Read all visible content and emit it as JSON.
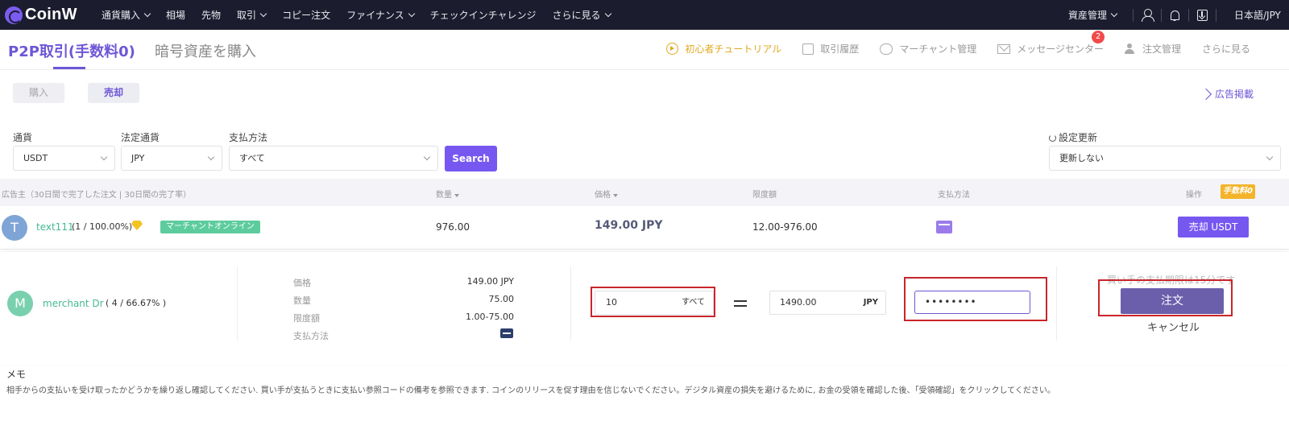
{
  "nav": {
    "logo": "CoinW",
    "items": [
      {
        "label": "通貨購入",
        "caret": true
      },
      {
        "label": "相場",
        "caret": false
      },
      {
        "label": "先物",
        "caret": false
      },
      {
        "label": "取引",
        "caret": true
      },
      {
        "label": "コピー注文",
        "caret": false
      },
      {
        "label": "ファイナンス",
        "caret": true
      },
      {
        "label": "チェックインチャレンジ",
        "caret": false
      },
      {
        "label": "さらに見る",
        "caret": true
      }
    ],
    "asset_management": "資産管理",
    "language": "日本語/JPY",
    "icons": [
      "user-icon",
      "bell-icon",
      "download-icon"
    ]
  },
  "subheader": {
    "tab_active": "P2P取引(手数料0)",
    "tab_inactive": "暗号資産を購入",
    "links": {
      "tutorial": "初心者チュートリアル",
      "history": "取引履歴",
      "merchant": "マーチャント管理",
      "messages": "メッセージセンター",
      "messages_badge": "2",
      "orders": "注文管理",
      "more": "さらに見る"
    }
  },
  "toggles": {
    "buy": "購入",
    "sell": "売却",
    "active": "sell"
  },
  "post_ad": "広告掲載",
  "filters": {
    "currency_label": "通貨",
    "currency_value": "USDT",
    "fiat_label": "法定通貨",
    "fiat_value": "JPY",
    "payment_label": "支払方法",
    "payment_value": "すべて",
    "search": "Search",
    "refresh_label": "設定更新",
    "refresh_value": "更新しない"
  },
  "table": {
    "headers": {
      "advertiser": "広告主（30日間で完了した注文 | 30日間の完了率）",
      "quantity": "数量",
      "price": "価格",
      "limit": "限度額",
      "payment": "支払方法",
      "action": "操作",
      "fee_badge": "手数料0"
    },
    "row": {
      "avatar": "T",
      "name": "text111",
      "stats": "(1 / 100.00%)",
      "tag": "マーチャントオンライン",
      "quantity": "976.00",
      "price": "149.00 JPY",
      "limit": "12.00-976.00",
      "action": "売却 USDT"
    }
  },
  "order_panel": {
    "avatar": "M",
    "name": "merchant Dr",
    "stats": "( 4 / 66.67% )",
    "details": [
      {
        "label": "価格",
        "value": "149.00 JPY"
      },
      {
        "label": "数量",
        "value": "75.00"
      },
      {
        "label": "限度額",
        "value": "1.00-75.00"
      },
      {
        "label": "支払方法",
        "value": ""
      }
    ],
    "quantity_value": "10",
    "quantity_all": "すべて",
    "amount_value": "1490.00",
    "amount_unit": "JPY",
    "password_value": "••••••••",
    "hint": "買い手の支払期限は15分です",
    "order_button": "注文",
    "cancel": "キャンセル"
  },
  "memo": {
    "title": "メモ",
    "text": "相手からの支払いを受け取ったかどうかを繰り返し確認してください. 買い手が支払うときに支払い参照コードの備考を参照できます. コインのリリースを促す理由を信じないでください。デジタル資産の損失を避けるために, お金の受領を確認した後、「受領確認」をクリックしてください。"
  },
  "colors": {
    "accent": "#7658f0",
    "nav_bg": "#1b1d2e",
    "green": "#45b892",
    "highlight": "#c9252b",
    "gold": "#e0a81f"
  }
}
